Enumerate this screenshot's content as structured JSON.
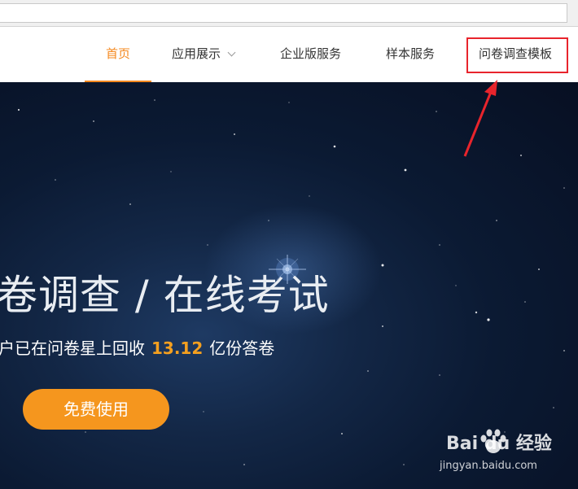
{
  "nav": {
    "items": [
      {
        "label": "首页",
        "active": true
      },
      {
        "label": "应用展示",
        "has_dropdown": true
      },
      {
        "label": "企业版服务"
      },
      {
        "label": "样本服务"
      },
      {
        "label": "问卷调查模板",
        "highlighted": true
      }
    ]
  },
  "hero": {
    "headline": "卷调查 / 在线考试",
    "sub_prefix": "户已在问卷星上回收",
    "sub_number": "13.12",
    "sub_suffix": "亿份答卷",
    "cta_label": "免费使用"
  },
  "watermark": {
    "logo": "Bai du 经验",
    "url": "jingyan.baidu.com"
  },
  "colors": {
    "accent": "#f5891f",
    "highlight_box": "#e8242c",
    "arrow": "#e8242c"
  }
}
